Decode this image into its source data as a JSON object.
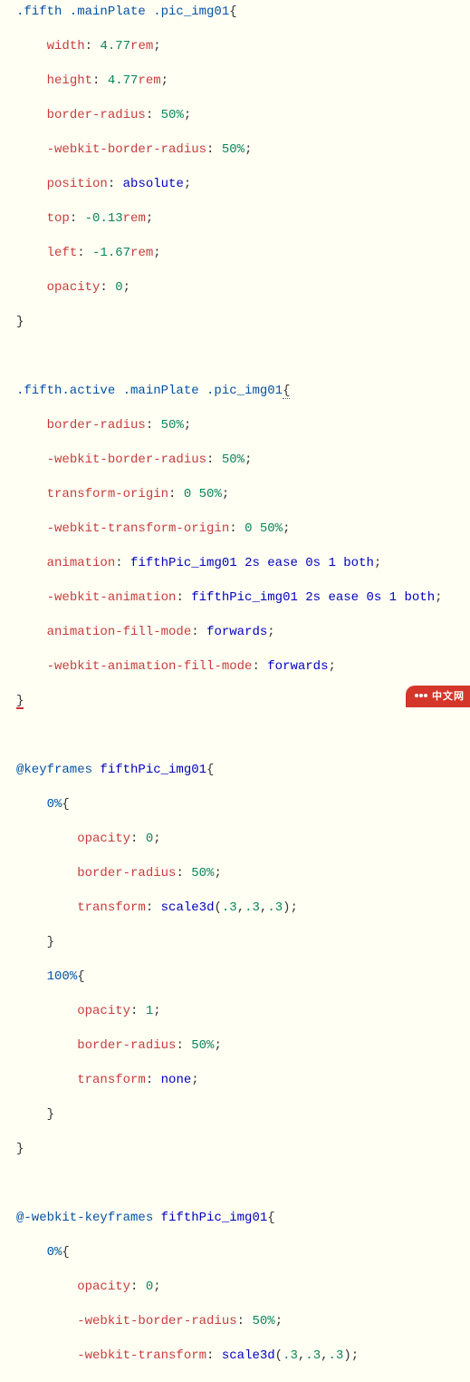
{
  "watermark": "中文网",
  "css_lines": [
    {
      "indent": 0,
      "parts": [
        {
          "c": "sel",
          "t": ".fifth .mainPlate .pic_img01"
        },
        {
          "c": "brace",
          "t": "{"
        }
      ]
    },
    {
      "indent": 1,
      "parts": [
        {
          "c": "prop",
          "t": "width"
        },
        {
          "c": "punct",
          "t": ": "
        },
        {
          "c": "val-num",
          "t": "4.77"
        },
        {
          "c": "unit",
          "t": "rem"
        },
        {
          "c": "punct",
          "t": ";"
        }
      ]
    },
    {
      "indent": 1,
      "parts": [
        {
          "c": "prop",
          "t": "height"
        },
        {
          "c": "punct",
          "t": ": "
        },
        {
          "c": "val-num",
          "t": "4.77"
        },
        {
          "c": "unit",
          "t": "rem"
        },
        {
          "c": "punct",
          "t": ";"
        }
      ]
    },
    {
      "indent": 1,
      "parts": [
        {
          "c": "prop",
          "t": "border-radius"
        },
        {
          "c": "punct",
          "t": ": "
        },
        {
          "c": "pct",
          "t": "50%"
        },
        {
          "c": "punct",
          "t": ";"
        }
      ]
    },
    {
      "indent": 1,
      "parts": [
        {
          "c": "prop",
          "t": "-webkit-border-radius"
        },
        {
          "c": "punct",
          "t": ": "
        },
        {
          "c": "pct",
          "t": "50%"
        },
        {
          "c": "punct",
          "t": ";"
        }
      ]
    },
    {
      "indent": 1,
      "parts": [
        {
          "c": "prop",
          "t": "position"
        },
        {
          "c": "punct",
          "t": ": "
        },
        {
          "c": "val-kw",
          "t": "absolute"
        },
        {
          "c": "punct",
          "t": ";"
        }
      ]
    },
    {
      "indent": 1,
      "parts": [
        {
          "c": "prop",
          "t": "top"
        },
        {
          "c": "punct",
          "t": ": "
        },
        {
          "c": "val-num",
          "t": "-0.13"
        },
        {
          "c": "unit",
          "t": "rem"
        },
        {
          "c": "punct",
          "t": ";"
        }
      ]
    },
    {
      "indent": 1,
      "parts": [
        {
          "c": "prop",
          "t": "left"
        },
        {
          "c": "punct",
          "t": ": "
        },
        {
          "c": "val-num",
          "t": "-1.67"
        },
        {
          "c": "unit",
          "t": "rem"
        },
        {
          "c": "punct",
          "t": ";"
        }
      ]
    },
    {
      "indent": 1,
      "parts": [
        {
          "c": "prop",
          "t": "opacity"
        },
        {
          "c": "punct",
          "t": ": "
        },
        {
          "c": "val-num",
          "t": "0"
        },
        {
          "c": "punct",
          "t": ";"
        }
      ]
    },
    {
      "indent": 0,
      "parts": [
        {
          "c": "brace",
          "t": "}"
        }
      ]
    },
    {
      "indent": 0,
      "parts": [
        {
          "c": "",
          "t": " "
        }
      ]
    },
    {
      "indent": 0,
      "parts": [
        {
          "c": "sel",
          "t": ".fifth.active .mainPlate .pic_img01"
        },
        {
          "c": "brace underline",
          "t": "{"
        }
      ]
    },
    {
      "indent": 1,
      "parts": [
        {
          "c": "prop",
          "t": "border-radius"
        },
        {
          "c": "punct",
          "t": ": "
        },
        {
          "c": "pct",
          "t": "50%"
        },
        {
          "c": "punct",
          "t": ";"
        }
      ]
    },
    {
      "indent": 1,
      "parts": [
        {
          "c": "prop",
          "t": "-webkit-border-radius"
        },
        {
          "c": "punct",
          "t": ": "
        },
        {
          "c": "pct",
          "t": "50%"
        },
        {
          "c": "punct",
          "t": ";"
        }
      ]
    },
    {
      "indent": 1,
      "parts": [
        {
          "c": "prop",
          "t": "transform-origin"
        },
        {
          "c": "punct",
          "t": ": "
        },
        {
          "c": "val-num",
          "t": "0"
        },
        {
          "c": "punct",
          "t": " "
        },
        {
          "c": "pct",
          "t": "50%"
        },
        {
          "c": "punct",
          "t": ";"
        }
      ]
    },
    {
      "indent": 1,
      "parts": [
        {
          "c": "prop",
          "t": "-webkit-transform-origin"
        },
        {
          "c": "punct",
          "t": ": "
        },
        {
          "c": "val-num",
          "t": "0"
        },
        {
          "c": "punct",
          "t": " "
        },
        {
          "c": "pct",
          "t": "50%"
        },
        {
          "c": "punct",
          "t": ";"
        }
      ]
    },
    {
      "indent": 1,
      "parts": [
        {
          "c": "prop",
          "t": "animation"
        },
        {
          "c": "punct",
          "t": ": "
        },
        {
          "c": "val-kw",
          "t": "fifthPic_img01 2s ease 0s 1 both"
        },
        {
          "c": "punct",
          "t": ";"
        }
      ]
    },
    {
      "indent": 1,
      "parts": [
        {
          "c": "prop",
          "t": "-webkit-animation"
        },
        {
          "c": "punct",
          "t": ": "
        },
        {
          "c": "val-kw",
          "t": "fifthPic_img01 2s ease 0s 1 both"
        },
        {
          "c": "punct",
          "t": ";"
        }
      ]
    },
    {
      "indent": 1,
      "parts": [
        {
          "c": "prop",
          "t": "animation-fill-mode"
        },
        {
          "c": "punct",
          "t": ": "
        },
        {
          "c": "val-kw",
          "t": "forwards"
        },
        {
          "c": "punct",
          "t": ";"
        }
      ]
    },
    {
      "indent": 1,
      "parts": [
        {
          "c": "prop",
          "t": "-webkit-animation-fill-mode"
        },
        {
          "c": "punct",
          "t": ": "
        },
        {
          "c": "val-kw",
          "t": "forwards"
        },
        {
          "c": "punct",
          "t": ";"
        }
      ]
    },
    {
      "indent": 0,
      "parts": [
        {
          "c": "brace error-underline",
          "t": "}"
        }
      ]
    },
    {
      "indent": 0,
      "parts": [
        {
          "c": "",
          "t": " "
        }
      ]
    },
    {
      "indent": 0,
      "parts": [
        {
          "c": "sel",
          "t": "@keyframes "
        },
        {
          "c": "val-kw",
          "t": "fifthPic_img01"
        },
        {
          "c": "brace",
          "t": "{"
        }
      ]
    },
    {
      "indent": 1,
      "parts": [
        {
          "c": "sel",
          "t": "0%"
        },
        {
          "c": "brace",
          "t": "{"
        }
      ]
    },
    {
      "indent": 2,
      "parts": [
        {
          "c": "prop",
          "t": "opacity"
        },
        {
          "c": "punct",
          "t": ": "
        },
        {
          "c": "val-num",
          "t": "0"
        },
        {
          "c": "punct",
          "t": ";"
        }
      ]
    },
    {
      "indent": 2,
      "parts": [
        {
          "c": "prop",
          "t": "border-radius"
        },
        {
          "c": "punct",
          "t": ": "
        },
        {
          "c": "pct",
          "t": "50%"
        },
        {
          "c": "punct",
          "t": ";"
        }
      ]
    },
    {
      "indent": 2,
      "parts": [
        {
          "c": "prop",
          "t": "transform"
        },
        {
          "c": "punct",
          "t": ": "
        },
        {
          "c": "val-kw",
          "t": "scale3d"
        },
        {
          "c": "punct",
          "t": "("
        },
        {
          "c": "val-num",
          "t": ".3"
        },
        {
          "c": "punct",
          "t": ","
        },
        {
          "c": "val-num",
          "t": ".3"
        },
        {
          "c": "punct",
          "t": ","
        },
        {
          "c": "val-num",
          "t": ".3"
        },
        {
          "c": "punct",
          "t": ");"
        }
      ]
    },
    {
      "indent": 1,
      "parts": [
        {
          "c": "brace",
          "t": "}"
        }
      ]
    },
    {
      "indent": 1,
      "parts": [
        {
          "c": "sel",
          "t": "100%"
        },
        {
          "c": "brace",
          "t": "{"
        }
      ]
    },
    {
      "indent": 2,
      "parts": [
        {
          "c": "prop",
          "t": "opacity"
        },
        {
          "c": "punct",
          "t": ": "
        },
        {
          "c": "val-num",
          "t": "1"
        },
        {
          "c": "punct",
          "t": ";"
        }
      ]
    },
    {
      "indent": 2,
      "parts": [
        {
          "c": "prop",
          "t": "border-radius"
        },
        {
          "c": "punct",
          "t": ": "
        },
        {
          "c": "pct",
          "t": "50%"
        },
        {
          "c": "punct",
          "t": ";"
        }
      ]
    },
    {
      "indent": 2,
      "parts": [
        {
          "c": "prop",
          "t": "transform"
        },
        {
          "c": "punct",
          "t": ": "
        },
        {
          "c": "val-kw",
          "t": "none"
        },
        {
          "c": "punct",
          "t": ";"
        }
      ]
    },
    {
      "indent": 1,
      "parts": [
        {
          "c": "brace",
          "t": "}"
        }
      ]
    },
    {
      "indent": 0,
      "parts": [
        {
          "c": "brace",
          "t": "}"
        }
      ]
    },
    {
      "indent": 0,
      "parts": [
        {
          "c": "",
          "t": " "
        }
      ]
    },
    {
      "indent": 0,
      "parts": [
        {
          "c": "sel",
          "t": "@-webkit-keyframes "
        },
        {
          "c": "val-kw",
          "t": "fifthPic_img01"
        },
        {
          "c": "brace",
          "t": "{"
        }
      ]
    },
    {
      "indent": 1,
      "parts": [
        {
          "c": "sel",
          "t": "0%"
        },
        {
          "c": "brace",
          "t": "{"
        }
      ]
    },
    {
      "indent": 2,
      "parts": [
        {
          "c": "prop",
          "t": "opacity"
        },
        {
          "c": "punct",
          "t": ": "
        },
        {
          "c": "val-num",
          "t": "0"
        },
        {
          "c": "punct",
          "t": ";"
        }
      ]
    },
    {
      "indent": 2,
      "parts": [
        {
          "c": "prop",
          "t": "-webkit-border-radius"
        },
        {
          "c": "punct",
          "t": ": "
        },
        {
          "c": "pct",
          "t": "50%"
        },
        {
          "c": "punct",
          "t": ";"
        }
      ]
    },
    {
      "indent": 2,
      "parts": [
        {
          "c": "prop",
          "t": "-webkit-transform"
        },
        {
          "c": "punct",
          "t": ": "
        },
        {
          "c": "val-kw",
          "t": "scale3d"
        },
        {
          "c": "punct",
          "t": "("
        },
        {
          "c": "val-num",
          "t": ".3"
        },
        {
          "c": "punct",
          "t": ","
        },
        {
          "c": "val-num",
          "t": ".3"
        },
        {
          "c": "punct",
          "t": ","
        },
        {
          "c": "val-num",
          "t": ".3"
        },
        {
          "c": "punct",
          "t": ");"
        }
      ]
    }
  ]
}
